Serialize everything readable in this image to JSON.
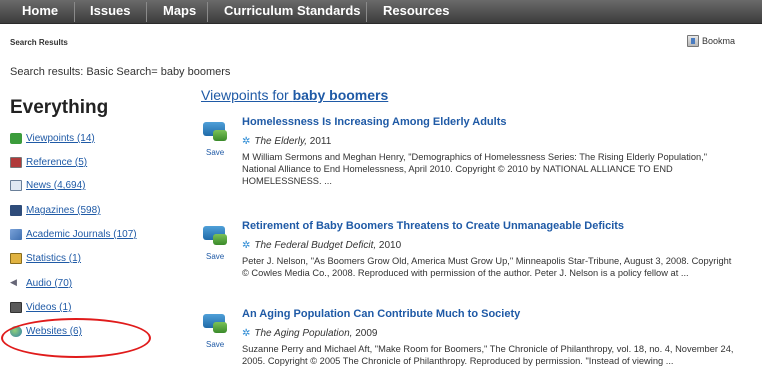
{
  "nav": {
    "items": [
      "Home",
      "Issues",
      "Maps",
      "Curriculum Standards",
      "Resources"
    ]
  },
  "breadcrumb": "Search Results",
  "bookmark_label": "Bookma",
  "search_summary": "Search results: Basic Search= baby boomers",
  "facet_heading": "Everything",
  "facets": [
    {
      "label": "Viewpoints (14)",
      "icon": "viewpoints-icon"
    },
    {
      "label": "Reference (5)",
      "icon": "reference-icon"
    },
    {
      "label": "News (4,694)",
      "icon": "news-icon"
    },
    {
      "label": "Magazines (598)",
      "icon": "magazines-icon"
    },
    {
      "label": "Academic Journals (107)",
      "icon": "journals-icon"
    },
    {
      "label": "Statistics (1)",
      "icon": "statistics-icon"
    },
    {
      "label": "Audio (70)",
      "icon": "audio-icon"
    },
    {
      "label": "Videos (1)",
      "icon": "videos-icon"
    },
    {
      "label": "Websites (6)",
      "icon": "globe-icon"
    }
  ],
  "viewpoints_heading": {
    "prefix": "Viewpoints for ",
    "term": "baby boomers"
  },
  "results": [
    {
      "title": "Homelessness Is Increasing Among Elderly Adults",
      "source": "The Elderly,",
      "year": "2011",
      "save": "Save",
      "lines": [
        "M William Sermons and Meghan Henry, \"Demographics of Homelessness Series: The Rising Elderly Population,\"",
        "National Alliance to End Homelessness, April 2010. Copyright © 2010 by NATIONAL ALLIANCE TO END",
        "HOMELESSNESS. ..."
      ]
    },
    {
      "title": "Retirement of Baby Boomers Threatens to Create Unmanageable Deficits",
      "source": "The Federal Budget Deficit,",
      "year": "2010",
      "save": "Save",
      "lines": [
        "Peter J. Nelson, \"As Boomers Grow Old, America Must Grow Up,\" Minneapolis Star-Tribune, August 3, 2008. Copyright",
        "© Cowles Media Co., 2008. Reproduced with permission of the author. Peter J. Nelson is a policy fellow at ..."
      ]
    },
    {
      "title": "An Aging Population Can Contribute Much to Society",
      "source": "The Aging Population,",
      "year": "2009",
      "save": "Save",
      "lines": [
        "Suzanne Perry and Michael Aft, \"Make Room for Boomers,\" The Chronicle of Philanthropy, vol. 18, no. 4, November 24,",
        "2005. Copyright © 2005 The Chronicle of Philanthropy. Reproduced by permission. \"Instead of viewing ..."
      ]
    }
  ],
  "colors": {
    "link": "#1f5aa6",
    "highlight_circle": "#e01b1b",
    "nav_bg": "#4a4a4a"
  }
}
